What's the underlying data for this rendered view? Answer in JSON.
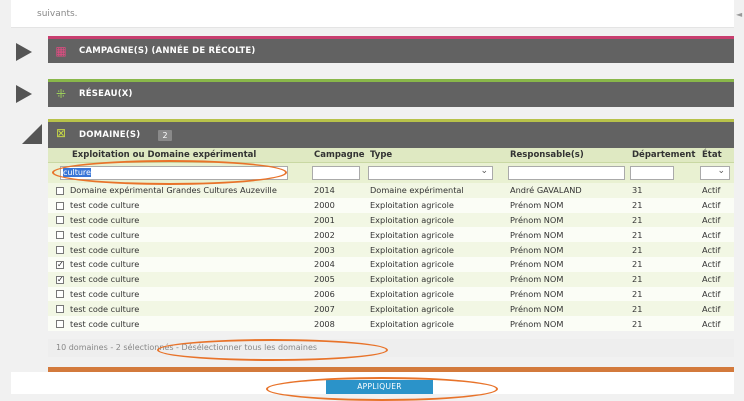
{
  "intro_text": "suivants.",
  "sections": {
    "campagne": {
      "title": "CAMPAGNE(S) (ANNÉE DE RÉCOLTE)",
      "icon": "calendar-icon",
      "accent": "#c83e6f"
    },
    "reseau": {
      "title": "RÉSEAU(X)",
      "icon": "network-icon",
      "accent": "#89b74a"
    },
    "domaine": {
      "title": "DOMAINE(S)",
      "count": "2",
      "icon": "map-icon",
      "accent": "#b8c24a"
    }
  },
  "table": {
    "headers": [
      "Exploitation ou Domaine expérimental",
      "Campagne",
      "Type",
      "Responsable(s)",
      "Département",
      "État"
    ],
    "filter": {
      "exploitation": "culture",
      "campagne": "",
      "type": "",
      "responsable": "",
      "departement": "",
      "etat": ""
    },
    "rows": [
      {
        "checked": false,
        "name": "Domaine expérimental Grandes Cultures Auzeville",
        "campagne": "2014",
        "type": "Domaine expérimental",
        "responsable": "André GAVALAND",
        "departement": "31",
        "etat": "Actif"
      },
      {
        "checked": false,
        "name": "test code culture",
        "campagne": "2000",
        "type": "Exploitation agricole",
        "responsable": "Prénom NOM",
        "departement": "21",
        "etat": "Actif"
      },
      {
        "checked": false,
        "name": "test code culture",
        "campagne": "2001",
        "type": "Exploitation agricole",
        "responsable": "Prénom NOM",
        "departement": "21",
        "etat": "Actif"
      },
      {
        "checked": false,
        "name": "test code culture",
        "campagne": "2002",
        "type": "Exploitation agricole",
        "responsable": "Prénom NOM",
        "departement": "21",
        "etat": "Actif"
      },
      {
        "checked": false,
        "name": "test code culture",
        "campagne": "2003",
        "type": "Exploitation agricole",
        "responsable": "Prénom NOM",
        "departement": "21",
        "etat": "Actif"
      },
      {
        "checked": true,
        "name": "test code culture",
        "campagne": "2004",
        "type": "Exploitation agricole",
        "responsable": "Prénom NOM",
        "departement": "21",
        "etat": "Actif"
      },
      {
        "checked": true,
        "name": "test code culture",
        "campagne": "2005",
        "type": "Exploitation agricole",
        "responsable": "Prénom NOM",
        "departement": "21",
        "etat": "Actif"
      },
      {
        "checked": false,
        "name": "test code culture",
        "campagne": "2006",
        "type": "Exploitation agricole",
        "responsable": "Prénom NOM",
        "departement": "21",
        "etat": "Actif"
      },
      {
        "checked": false,
        "name": "test code culture",
        "campagne": "2007",
        "type": "Exploitation agricole",
        "responsable": "Prénom NOM",
        "departement": "21",
        "etat": "Actif"
      },
      {
        "checked": false,
        "name": "test code culture",
        "campagne": "2008",
        "type": "Exploitation agricole",
        "responsable": "Prénom NOM",
        "departement": "21",
        "etat": "Actif"
      }
    ]
  },
  "footer": {
    "summary": "10 domaines - 2 sélectionnés - ",
    "deselect_link": "Désélectionner tous les domaines"
  },
  "apply_button": "APPLIQUER",
  "colors": {
    "annotation": "#e8732a",
    "apply": "#2b93c9",
    "bottom_accent": "#d37a3c"
  }
}
